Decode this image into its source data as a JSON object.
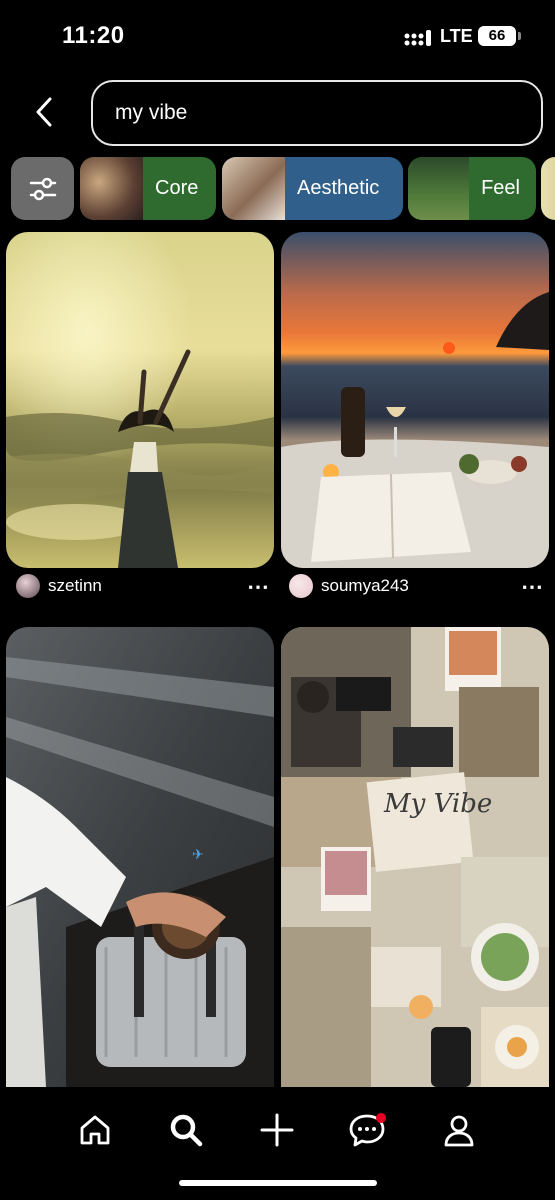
{
  "status_bar": {
    "time": "11:20",
    "network": "LTE",
    "battery": "66"
  },
  "search": {
    "value": "my vibe"
  },
  "chips": [
    {
      "label": "Core",
      "color": "#2f6b2f"
    },
    {
      "label": "Aesthetic",
      "color": "#2f5f8a"
    },
    {
      "label": "Feel",
      "color": "#2f6b2f"
    }
  ],
  "pins": [
    {
      "user": "szetinn",
      "image": "woman dancing on beach at golden sunset"
    },
    {
      "user": "soumya243",
      "image": "beach picnic at sunset with wine and book"
    },
    {
      "user": "",
      "image": "hand holding coffee cup and suitcase on airport walkway"
    },
    {
      "user": "",
      "image": "my vibe collage"
    }
  ],
  "collage_text": "My Vibe",
  "nav": [
    "home-icon",
    "search-icon",
    "create-icon",
    "messages-icon",
    "profile-icon"
  ],
  "colors": {
    "accent_dot": "#e60023",
    "background": "#000000"
  }
}
